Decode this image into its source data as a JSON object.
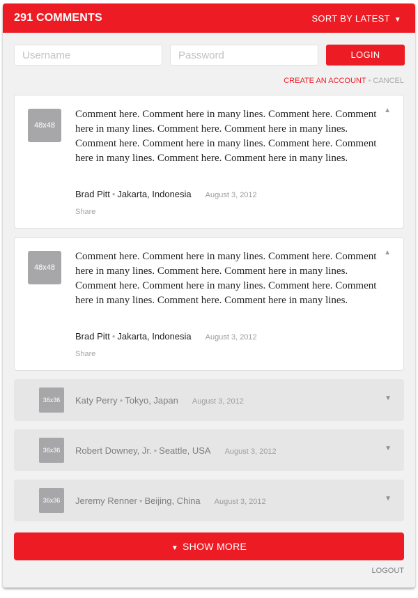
{
  "header": {
    "comment_count": "291 COMMENTS",
    "sort_label": "SORT BY LATEST",
    "sort_arrow": "▼"
  },
  "login_form": {
    "username_placeholder": "Username",
    "password_placeholder": "Password",
    "login_label": "LOGIN",
    "create_account_label": "CREATE AN ACCOUNT",
    "separator": "•",
    "cancel_label": "CANCEL"
  },
  "comments": [
    {
      "avatar": "48x48",
      "text": "Comment here. Comment here in many lines. Comment here. Comment here in many lines. Comment here. Comment here in many lines. Comment here. Comment here in many lines. Comment here. Comment here in many lines. Comment here. Comment here in many lines.",
      "author": "Brad Pitt",
      "location": "Jakarta, Indonesia",
      "date": "August 3, 2012",
      "share_label": "Share",
      "toggle": "▲"
    },
    {
      "avatar": "48x48",
      "text": "Comment here. Comment here in many lines. Comment here. Comment here in many lines. Comment here. Comment here in many lines. Comment here. Comment here in many lines. Comment here. Comment here in many lines. Comment here. Comment here in many lines.",
      "author": "Brad Pitt",
      "location": "Jakarta, Indonesia",
      "date": "August 3, 2012",
      "share_label": "Share",
      "toggle": "▲"
    }
  ],
  "collapsed_comments": [
    {
      "avatar": "36x36",
      "author": "Katy Perry",
      "location": "Tokyo, Japan",
      "date": "August 3, 2012",
      "toggle": "▼"
    },
    {
      "avatar": "36x36",
      "author": "Robert Downey, Jr.",
      "location": "Seattle, USA",
      "date": "August 3, 2012",
      "toggle": "▼"
    },
    {
      "avatar": "36x36",
      "author": "Jeremy Renner",
      "location": "Beijing, China",
      "date": "August 3, 2012",
      "toggle": "▼"
    }
  ],
  "footer": {
    "show_more_arrow": "▼",
    "show_more_label": "SHOW MORE",
    "logout_label": "LOGOUT"
  },
  "colors": {
    "accent": "#ed1c24",
    "panel_background": "#f1f1f2",
    "collapsed_background": "#e6e6e7",
    "avatar_placeholder": "#a7a7a9"
  }
}
